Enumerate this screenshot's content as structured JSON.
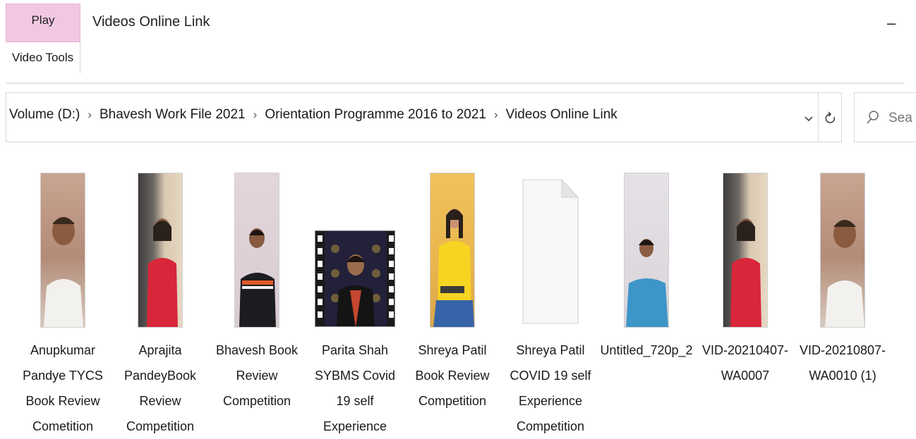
{
  "ribbon": {
    "play_tab": "Play",
    "context_group": "Video Tools",
    "window_title": "Videos Online Link",
    "minimize_glyph": "–"
  },
  "address": {
    "crumbs": [
      "Volume (D:)",
      "Bhavesh Work File 2021",
      "Orientation Programme 2016 to 2021",
      "Videos Online Link"
    ],
    "separator": "›",
    "dropdown_glyph": "⌄",
    "refresh_icon": "refresh-icon"
  },
  "search": {
    "placeholder": "Search Videos Online Link",
    "visible_text": "Sea"
  },
  "files": [
    {
      "name": "Anupkumar Pandye TYCS Book Review Cometition",
      "thumb": "portrait-man-white-shirt"
    },
    {
      "name": "Aprajita PandeyBook Review Competition",
      "thumb": "portrait-woman-red-dress"
    },
    {
      "name": "Bhavesh Book Review Competition",
      "thumb": "portrait-man-black-jacket"
    },
    {
      "name": "Parita Shah SYBMS Covid 19 self Experience",
      "thumb": "film-strip-woman"
    },
    {
      "name": "Shreya Patil Book Review Competition",
      "thumb": "portrait-woman-yellow-top"
    },
    {
      "name": "Shreya Patil COVID 19 self Experience Competition",
      "thumb": "blank-document-icon"
    },
    {
      "name": "Untitled_720p_2",
      "thumb": "portrait-man-blue-shirt"
    },
    {
      "name": "VID-20210407-WA0007",
      "thumb": "portrait-woman-red-dress"
    },
    {
      "name": "VID-20210807-WA0010 (1)",
      "thumb": "portrait-man-white-shirt"
    }
  ],
  "colors": {
    "play_tab_bg": "#f2c7e3",
    "border": "#d9d9d9"
  }
}
